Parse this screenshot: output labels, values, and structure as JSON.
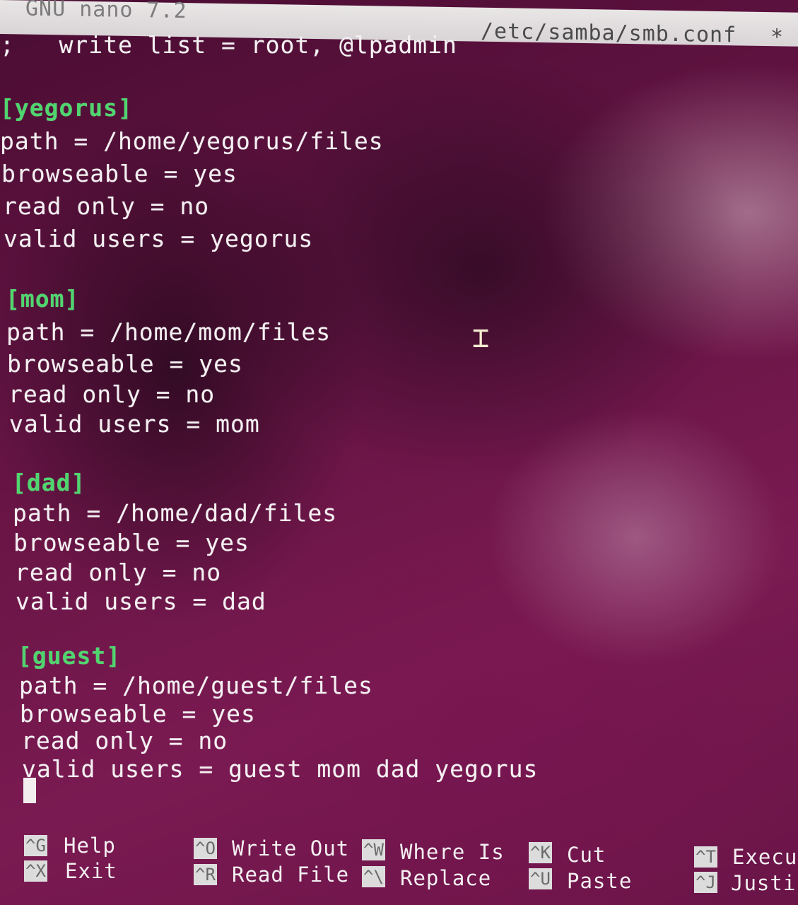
{
  "titlebar": {
    "app": "GNU nano 7.2",
    "file": "/etc/samba/smb.conf",
    "modified": "*"
  },
  "lines": [
    ";   write list = root, @lpadmin",
    "[yegorus]",
    "path = /home/yegorus/files",
    "browseable = yes",
    "read only = no",
    "valid users = yegorus",
    "[mom]",
    "path = /home/mom/files",
    "browseable = yes",
    "read only = no",
    "valid users = mom",
    "[dad]",
    "path = /home/dad/files",
    "browseable = yes",
    "read only = no",
    "valid users = dad",
    "[guest]",
    "path = /home/guest/files",
    "browseable = yes",
    "read only = no",
    "valid users = guest mom dad yegorus"
  ],
  "shortcuts": [
    {
      "key": "^G",
      "label": "Help"
    },
    {
      "key": "^X",
      "label": "Exit"
    },
    {
      "key": "^O",
      "label": "Write Out"
    },
    {
      "key": "^R",
      "label": "Read File"
    },
    {
      "key": "^W",
      "label": "Where Is"
    },
    {
      "key": "^\\",
      "label": "Replace"
    },
    {
      "key": "^K",
      "label": "Cut"
    },
    {
      "key": "^U",
      "label": "Paste"
    },
    {
      "key": "^T",
      "label": "Execu"
    },
    {
      "key": "^J",
      "label": "Justi"
    }
  ],
  "colors": {
    "section_header": "#4fd66e",
    "text": "#f4f0f2",
    "background": "#6a1546",
    "titlebar": "#e3dfe0"
  }
}
